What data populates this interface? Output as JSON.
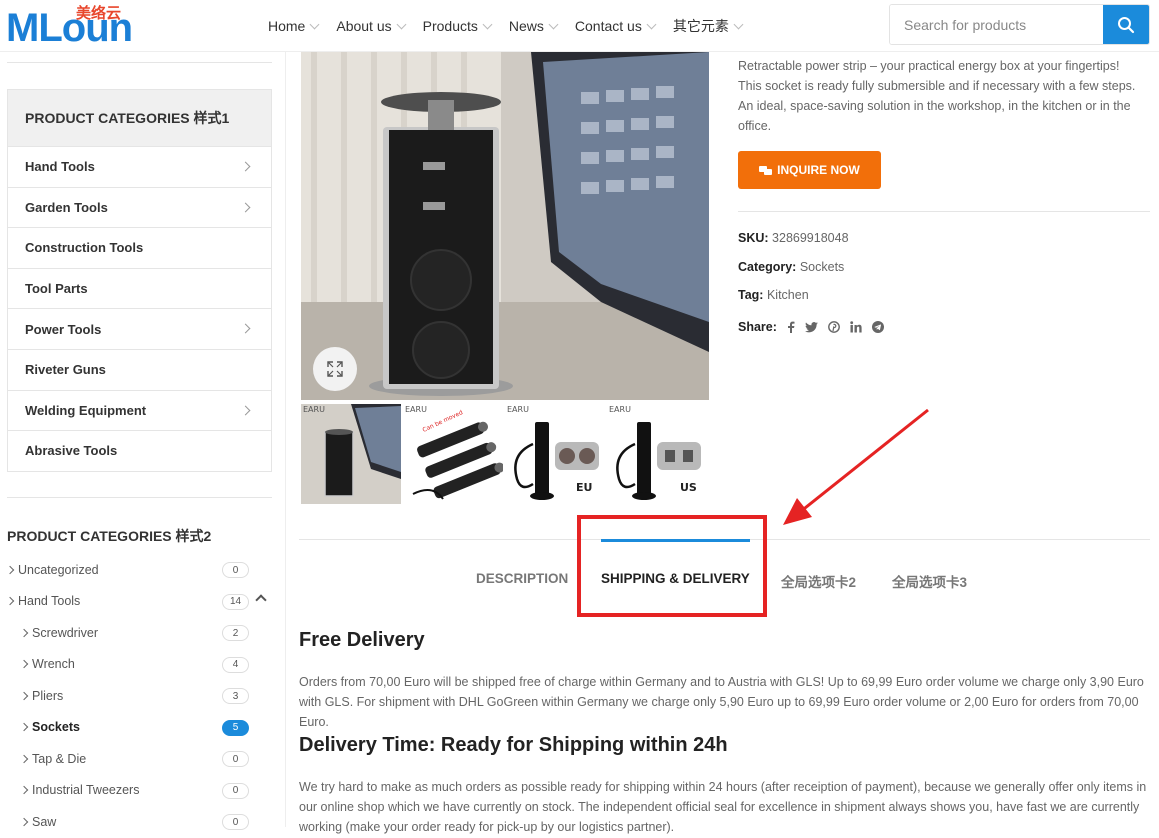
{
  "brand": {
    "logo_text": "MLoun",
    "logo_cn": "美络云"
  },
  "nav": [
    {
      "label": "Home"
    },
    {
      "label": "About us"
    },
    {
      "label": "Products"
    },
    {
      "label": "News"
    },
    {
      "label": "Contact us"
    },
    {
      "label": "其它元素"
    }
  ],
  "search": {
    "placeholder": "Search for products"
  },
  "sidebar": {
    "cat1_title": "PRODUCT CATEGORIES 样式1",
    "cat1_items": [
      {
        "label": "Hand Tools",
        "has_sub": true
      },
      {
        "label": "Garden Tools",
        "has_sub": true
      },
      {
        "label": "Construction Tools",
        "has_sub": false
      },
      {
        "label": "Tool Parts",
        "has_sub": false
      },
      {
        "label": "Power Tools",
        "has_sub": true
      },
      {
        "label": "Riveter Guns",
        "has_sub": false
      },
      {
        "label": "Welding Equipment",
        "has_sub": true
      },
      {
        "label": "Abrasive Tools",
        "has_sub": false
      }
    ],
    "cat2_title": "PRODUCT CATEGORIES 样式2",
    "cat2_items": [
      {
        "label": "Uncategorized",
        "count": "0",
        "sub": false
      },
      {
        "label": "Hand Tools",
        "count": "14",
        "sub": false,
        "expanded": true
      },
      {
        "label": "Screwdriver",
        "count": "2",
        "sub": true
      },
      {
        "label": "Wrench",
        "count": "4",
        "sub": true
      },
      {
        "label": "Pliers",
        "count": "3",
        "sub": true
      },
      {
        "label": "Sockets",
        "count": "5",
        "sub": true,
        "active": true
      },
      {
        "label": "Tap & Die",
        "count": "0",
        "sub": true
      },
      {
        "label": "Industrial Tweezers",
        "count": "0",
        "sub": true
      },
      {
        "label": "Saw",
        "count": "0",
        "sub": true
      }
    ]
  },
  "product": {
    "thumb_tags": [
      "EARU",
      "EARU",
      "EARU",
      "EARU"
    ],
    "thumb_extra": {
      "moved": "Can be moved",
      "eu": "EU",
      "us": "US"
    },
    "short_description": "Retractable power strip – your practical energy box at your fingertips! This socket is ready fully submersible and if necessary with a few steps. An ideal, space-saving solution in the workshop, in the kitchen or in the office.",
    "inquire_label": "INQUIRE NOW",
    "sku_label": "SKU:",
    "sku": "32869918048",
    "category_label": "Category:",
    "category": "Sockets",
    "tag_label": "Tag:",
    "tag": "Kitchen",
    "share_label": "Share:",
    "share_icons": [
      "facebook-icon",
      "twitter-icon",
      "pinterest-icon",
      "linkedin-icon",
      "telegram-icon"
    ]
  },
  "tabs": [
    {
      "label": "DESCRIPTION",
      "active": false
    },
    {
      "label": "SHIPPING & DELIVERY",
      "active": true
    },
    {
      "label": "全局选项卡2",
      "active": false
    },
    {
      "label": "全局选项卡3",
      "active": false
    }
  ],
  "content": {
    "h1": "Free Delivery",
    "p1": "Orders from 70,00 Euro will be shipped free of charge within Germany and to Austria with GLS! Up to 69,99 Euro order volume we charge only 3,90 Euro with GLS. For shipment with DHL GoGreen within Germany we charge only 5,90 Euro up to 69,99 Euro order volume or 2,00 Euro for orders from 70,00 Euro.",
    "h2": "Delivery Time: Ready for Shipping within 24h",
    "p2": "We try hard to make as much orders as possible ready for shipping within 24 hours (after receiption of payment), because we generally offer only items in our online shop which we have currently on stock. The independent official seal for excellence in shipment always shows you, have fast we are currently working (make your order ready for pick-up by our logistics partner)."
  },
  "colors": {
    "accent": "#1b8bdb",
    "inquire": "#f26f0a",
    "annotation": "#e52323"
  }
}
